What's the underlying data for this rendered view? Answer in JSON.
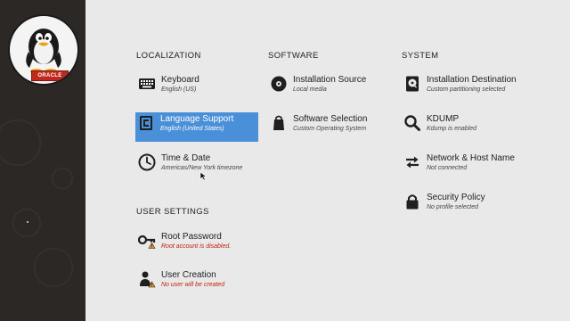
{
  "brand": {
    "logo_text": "ORACLE"
  },
  "sections": {
    "localization": {
      "title": "LOCALIZATION",
      "items": [
        {
          "name": "Keyboard",
          "status": "English (US)",
          "icon": "keyboard-icon"
        },
        {
          "name": "Language Support",
          "status": "English (United States)",
          "icon": "language-icon",
          "selected": true
        },
        {
          "name": "Time & Date",
          "status": "Americas/New York timezone",
          "icon": "clock-icon"
        }
      ]
    },
    "software": {
      "title": "SOFTWARE",
      "items": [
        {
          "name": "Installation Source",
          "status": "Local media",
          "icon": "disc-icon"
        },
        {
          "name": "Software Selection",
          "status": "Custom Operating System",
          "icon": "package-icon"
        }
      ]
    },
    "system": {
      "title": "SYSTEM",
      "items": [
        {
          "name": "Installation Destination",
          "status": "Custom partitioning selected",
          "icon": "harddisk-icon"
        },
        {
          "name": "KDUMP",
          "status": "Kdump is enabled",
          "icon": "search-icon"
        },
        {
          "name": "Network & Host Name",
          "status": "Not connected",
          "icon": "network-arrows-icon"
        },
        {
          "name": "Security Policy",
          "status": "No profile selected",
          "icon": "lock-icon"
        }
      ]
    },
    "user_settings": {
      "title": "USER SETTINGS",
      "items": [
        {
          "name": "Root Password",
          "status": "Root account is disabled.",
          "icon": "key-warning-icon",
          "warning": true
        },
        {
          "name": "User Creation",
          "status": "No user will be created",
          "icon": "user-warning-icon",
          "warning": true
        }
      ]
    }
  },
  "colors": {
    "selected_bg": "#4a90d9",
    "warning_text": "#c4200e",
    "sidebar_bg": "#2b2826"
  }
}
